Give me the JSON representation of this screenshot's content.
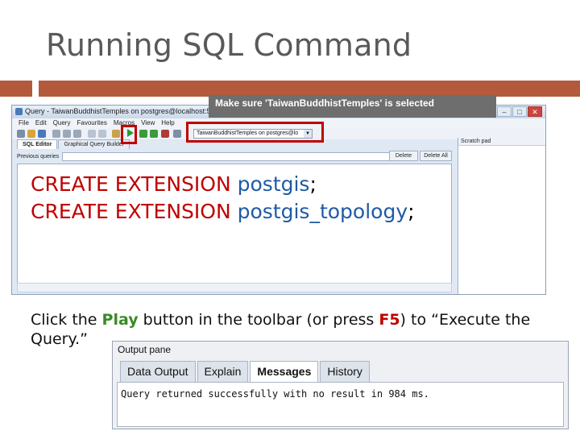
{
  "slide": {
    "title": "Running SQL Command",
    "callout": "Make sure 'TaiwanBuddhistTemples' is selected",
    "instruction": {
      "before": "Click the ",
      "play": "Play",
      "middle": " button in the toolbar (or press ",
      "key": "F5",
      "after": ") to “Execute the Query.”"
    }
  },
  "pgadmin": {
    "window_title": "Query - TaiwanBuddhistTemples on postgres@localhost:5432",
    "menu": [
      "File",
      "Edit",
      "Query",
      "Favourites",
      "Macros",
      "View",
      "Help"
    ],
    "database_selector": "TaiwanBuddhistTemples on postgres@lo",
    "tabs": [
      "SQL Editor",
      "Graphical Query Builder"
    ],
    "previous_queries_label": "Previous queries",
    "delete_button": "Delete",
    "delete_all_button": "Delete All",
    "scratch_pad_label": "Scratch pad",
    "sql": {
      "line1_keyword": "CREATE EXTENSION ",
      "line1_ext": "postgis",
      "line2_keyword": "CREATE EXTENSION ",
      "line2_ext": "postgis_topology",
      "semicolon": ";"
    }
  },
  "output_pane": {
    "title": "Output pane",
    "tabs": [
      "Data Output",
      "Explain",
      "Messages",
      "History"
    ],
    "active_tab": "Messages",
    "message": "Query returned successfully with no result in 984 ms."
  },
  "colors": {
    "accent_bar": "#b35a3c",
    "highlight_box": "#c00000",
    "keyword": "#c00000",
    "extension_name": "#1f5aa6",
    "play_text": "#3a8a25"
  }
}
